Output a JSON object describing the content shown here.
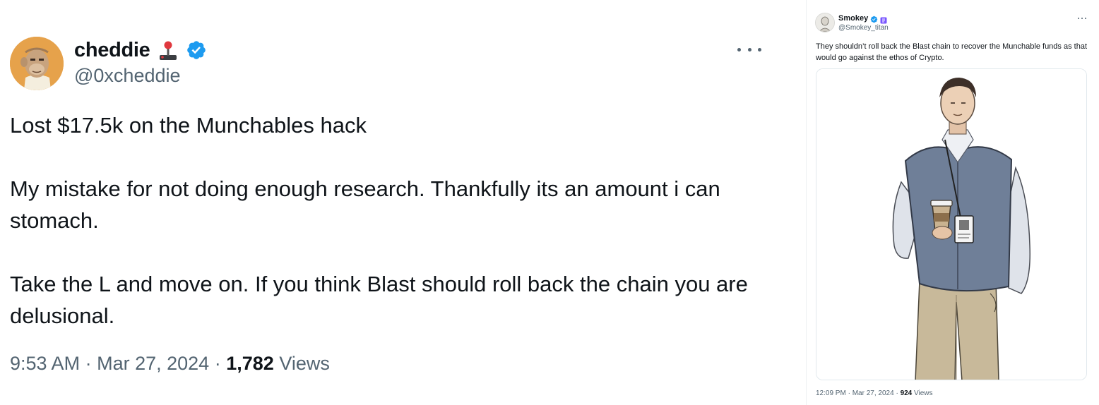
{
  "left_tweet": {
    "display_name": "cheddie",
    "name_emoji": "🕹",
    "handle": "@0xcheddie",
    "body": [
      "Lost $17.5k on the Munchables hack",
      "My mistake for not doing enough research. Thankfully its an amount i can stomach.",
      "Take the L and move on. If you think Blast should roll back the chain you are delusional."
    ],
    "time": "9:53 AM",
    "date": "Mar 27, 2024",
    "views_count": "1,782",
    "views_label": "Views",
    "separator": "·"
  },
  "right_tweet": {
    "display_name": "Smokey",
    "handle": "@Smokey_titan",
    "body": "They shouldn’t roll back the Blast chain to recover the Munchable funds as that would go against the ethos of Crypto.",
    "time": "12:09 PM",
    "date": "Mar 27, 2024",
    "views_count": "924",
    "views_label": "Views",
    "separator": "·"
  },
  "colors": {
    "verified_blue": "#1d9bf0",
    "badge_purple": "#7856ff",
    "secondary_text": "#536471",
    "primary_text": "#0f1419"
  }
}
